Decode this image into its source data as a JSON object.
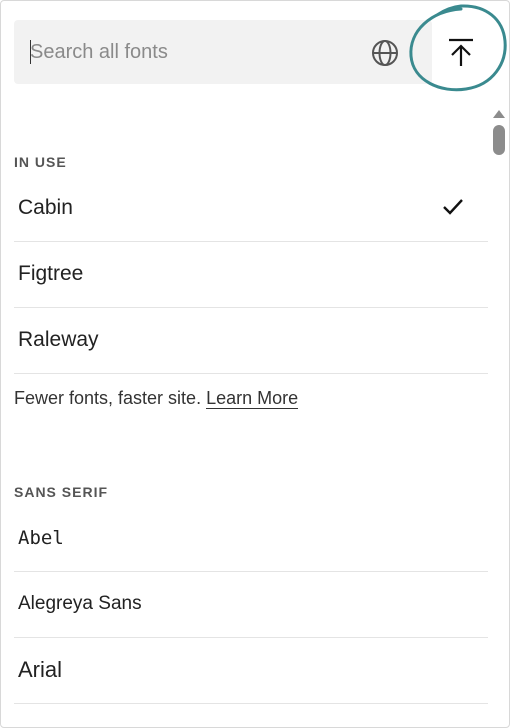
{
  "search": {
    "placeholder": "Search all fonts",
    "value": ""
  },
  "icons": {
    "globe": "globe-icon",
    "upload": "upload-to-top-icon",
    "check": "check-icon"
  },
  "sections": {
    "in_use": {
      "header": "IN USE",
      "items": [
        {
          "label": "Cabin",
          "selected": true
        },
        {
          "label": "Figtree",
          "selected": false
        },
        {
          "label": "Raleway",
          "selected": false
        }
      ],
      "note_text": "Fewer fonts, faster site.",
      "note_link": "Learn More"
    },
    "sans_serif": {
      "header": "SANS SERIF",
      "items": [
        {
          "label": "Abel"
        },
        {
          "label": "Alegreya Sans"
        },
        {
          "label": "Arial"
        }
      ]
    }
  },
  "colors": {
    "annotation_circle": "#3a8a8f",
    "search_bg": "#f2f2f2",
    "divider": "#e4e4e4"
  }
}
